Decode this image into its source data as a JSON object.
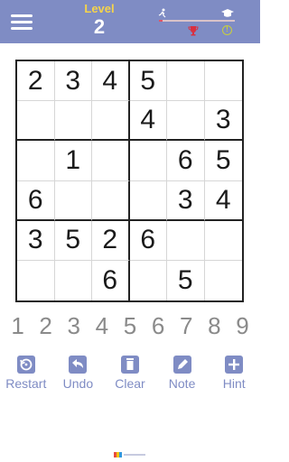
{
  "header": {
    "level_label": "Level",
    "level_value": "2",
    "progress_fraction": 0.05,
    "icons": [
      "menu-icon",
      "runner-icon",
      "graduation-cap-icon",
      "trophy-icon",
      "info-icon"
    ],
    "colors": {
      "bar": "#7f8cc4",
      "level": "#f6d44a",
      "progress": "#e05466"
    }
  },
  "board": {
    "cells": [
      [
        "2",
        "3",
        "4",
        "5",
        "",
        ""
      ],
      [
        "",
        "",
        "",
        "4",
        "",
        "3"
      ],
      [
        "",
        "1",
        "",
        "",
        "6",
        "5"
      ],
      [
        "6",
        "",
        "",
        "",
        "3",
        "4"
      ],
      [
        "3",
        "5",
        "2",
        "6",
        "",
        ""
      ],
      [
        "",
        "",
        "6",
        "",
        "5",
        ""
      ]
    ]
  },
  "numpad": [
    "1",
    "2",
    "3",
    "4",
    "5",
    "6",
    "7",
    "8",
    "9"
  ],
  "tools": [
    {
      "label": "Restart",
      "icon": "restart-icon"
    },
    {
      "label": "Undo",
      "icon": "undo-icon"
    },
    {
      "label": "Clear",
      "icon": "trash-icon"
    },
    {
      "label": "Note",
      "icon": "pencil-icon"
    },
    {
      "label": "Hint",
      "icon": "plus-icon"
    }
  ],
  "footer": {
    "icon": "brand-logo-icon"
  }
}
